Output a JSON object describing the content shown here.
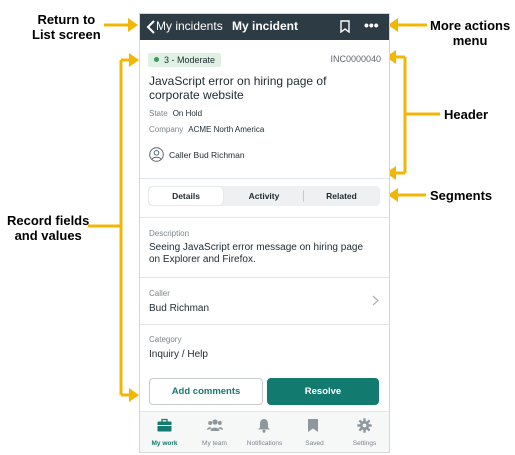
{
  "annotations": {
    "return_to_list": [
      "Return to",
      "List screen"
    ],
    "more_actions": [
      "More actions",
      "menu"
    ],
    "header": "Header",
    "segments": "Segments",
    "record_fields": [
      "Record fields",
      "and values"
    ]
  },
  "topbar": {
    "back_label": "My incidents",
    "title": "My incident",
    "bookmark_icon": "bookmark-icon",
    "more_label": "•••"
  },
  "record": {
    "priority": "3 - Moderate",
    "number": "INC0000040",
    "short_description": "JavaScript error on hiring page of corporate website",
    "state_label": "State",
    "state_value": "On Hold",
    "company_label": "Company",
    "company_value": "ACME North America",
    "caller_line": "Caller Bud Richman"
  },
  "segments": {
    "items": [
      "Details",
      "Activity",
      "Related"
    ],
    "active": "Details"
  },
  "fields": {
    "description_label": "Description",
    "description_value": "Seeing JavaScript error message on hiring page on Explorer and Firefox.",
    "caller_label": "Caller",
    "caller_value": "Bud Richman",
    "category_label": "Category",
    "category_value": "Inquiry / Help"
  },
  "actions": {
    "add_comments": "Add comments",
    "resolve": "Resolve"
  },
  "tabbar": {
    "items": [
      "My work",
      "My team",
      "Notifications",
      "Saved",
      "Settings"
    ],
    "active": "My work"
  },
  "colors": {
    "topbar": "#2d3c44",
    "accent": "#127a6e",
    "annotation_arrow": "#f2b705",
    "badge_bg": "#dff1e3"
  }
}
